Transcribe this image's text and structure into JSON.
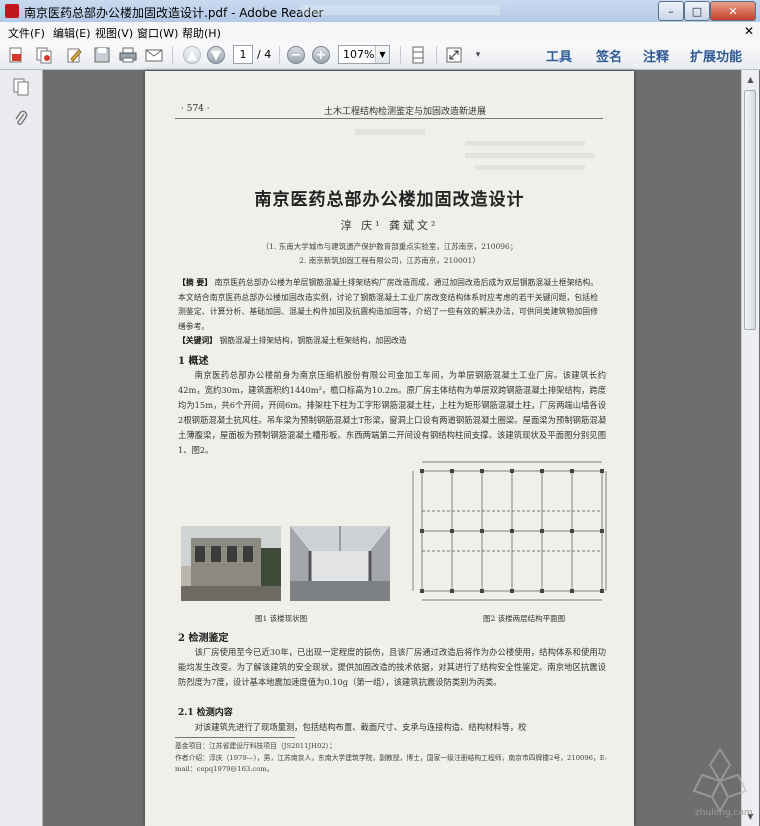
{
  "window": {
    "title": "南京医药总部办公楼加固改造设计.pdf - Adobe Reader",
    "buttons": {
      "minimize": "–",
      "maximize": "□",
      "close": "✕"
    }
  },
  "menu": {
    "items": [
      "文件(F)",
      "编辑(E)",
      "视图(V)",
      "窗口(W)",
      "帮助(H)"
    ],
    "close": "✕"
  },
  "toolbar": {
    "page_current": "1",
    "page_total": "/ 4",
    "zoom": "107%",
    "links": [
      "工具",
      "签名",
      "注释",
      "扩展功能"
    ]
  },
  "document": {
    "header_left": "· 574 ·",
    "header_center": "土木工程结构检测鉴定与加固改造新进展",
    "title": "南京医药总部办公楼加固改造设计",
    "authors": "淳  庆¹   龚斌文²",
    "affiliation1": "（1. 东南大学城市与建筑遗产保护教育部重点实验室，江苏南京，210096；",
    "affiliation2": "2. 南京新筑加固工程有限公司，江苏南京，210001）",
    "abstract_label": "【摘  要】",
    "abstract": "南京医药总部办公楼为单层钢筋混凝土排架结构厂房改造而成，通过加固改造后成为双层钢筋混凝土框架结构。本文结合南京医药总部办公楼加固改造实例，讨论了钢筋混凝土工业厂房改变结构体系时应考虑的若干关键问题，包括检测鉴定、计算分析、基础加固、混凝土构件加固及抗震构造加固等，介绍了一些有效的解决办法，可供同类建筑物加固修缮参考。",
    "keywords_label": "【关键词】",
    "keywords": "钢筋混凝土排架结构，钢筋混凝土框架结构，加固改造",
    "sec1": "1  概述",
    "sec1_body": "南京医药总部办公楼前身为南京压缩机股份有限公司金加工车间，为单层钢筋混凝土工业厂房。该建筑长约42m，宽约30m，建筑面积约1440m²，檐口标高为10.2m。原厂房主体结构为单层双跨钢筋混凝土排架结构，跨度均为15m，共6个开间，开间6m。排架柱下柱为工字形钢筋混凝土柱，上柱为矩形钢筋混凝土柱，厂房两端山墙各设2根钢筋混凝土抗风柱。吊车梁为预制钢筋混凝土T形梁，窗洞上口设有两道钢筋混凝土圈梁。屋面梁为预制钢筋混凝土薄腹梁，屋面板为预制钢筋混凝土槽形板。东西两端第二开间设有钢结构柱间支撑。该建筑现状及平面图分别见图1、图2。",
    "fig1_caption": "图1  该楼现状图",
    "fig2_caption": "图2  该楼两层结构平面图",
    "sec2": "2  检测鉴定",
    "sec2_body": "该厂房使用至今已近30年，已出现一定程度的损伤，且该厂房通过改造后将作为办公楼使用，结构体系和使用功能均发生改变。为了解该建筑的安全现状，提供加固改造的技术依据，对其进行了结构安全性鉴定。南京地区抗震设防烈度为7度，设计基本地震加速度值为0.10g（第一组），该建筑抗震设防类别为丙类。",
    "sec21": "2.1  检测内容",
    "sec21_body": "对该建筑先进行了现场量测，包括结构布置、截面尺寸、支承与连接构造、结构材料等，校",
    "footnote1": "基金项目：江苏省建设厅科技项目（JS2011JH02）；",
    "footnote2": "作者介绍：淳庆（1979—），男，江苏南京人，东南大学建筑学院，副教授，博士，国家一级注册结构工程师，南京市四牌楼2号，210096，E-mail：cepq1979@163.com。"
  },
  "watermark_text": "zhulong.com"
}
